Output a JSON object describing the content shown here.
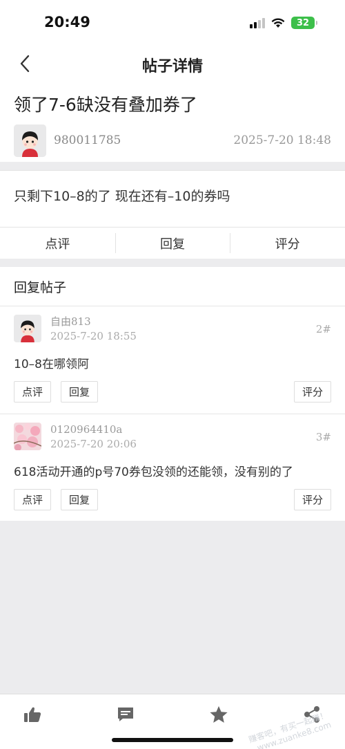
{
  "status_bar": {
    "time": "20:49",
    "battery": "32"
  },
  "nav": {
    "title": "帖子详情"
  },
  "post": {
    "title": "领了7-6缺没有叠加券了",
    "author": "980011785",
    "date": "2025-7-20 18:48",
    "body": "只剩下10–8的了    现在还有–10的券吗"
  },
  "post_actions": [
    {
      "label": "点评"
    },
    {
      "label": "回复"
    },
    {
      "label": "评分"
    }
  ],
  "replies_header": "回复帖子",
  "replies": [
    {
      "user": "自由813",
      "date": "2025-7-20 18:55",
      "floor": "2#",
      "text": "10–8在哪领阿",
      "avatar_icon": "cartoon-boy-avatar",
      "actions": {
        "comment": "点评",
        "reply": "回复",
        "rate": "评分"
      }
    },
    {
      "user": "0120964410a",
      "date": "2025-7-20 20:06",
      "floor": "3#",
      "text": "618活动开通的p号70券包没领的还能领，没有别的了",
      "avatar_icon": "cherry-blossom-avatar",
      "actions": {
        "comment": "点评",
        "reply": "回复",
        "rate": "评分"
      }
    }
  ],
  "tabbar": {
    "icons": [
      "thumbs-up-icon",
      "comment-icon",
      "star-icon",
      "share-icon"
    ]
  },
  "watermark": {
    "line1": "赚客吧，有买一起赚！",
    "line2": "www.zuanke8.com"
  },
  "colors": {
    "accent_battery": "#3dbf4a",
    "text": "#222222",
    "muted": "#999999"
  }
}
